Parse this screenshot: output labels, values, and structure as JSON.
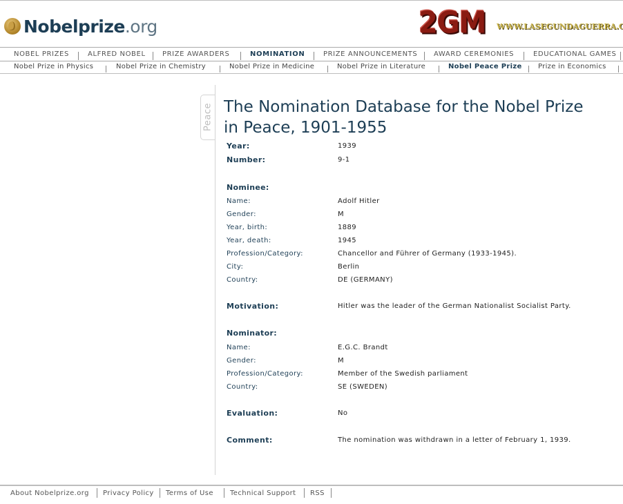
{
  "site": {
    "logo_text": "Nobelprize",
    "logo_suffix": ".org"
  },
  "brand": {
    "badge": "2GM",
    "url_text": "WWW.LASEGUNDAGUERRA.COM"
  },
  "nav_main": [
    {
      "label": "NOBEL PRIZES"
    },
    {
      "label": "ALFRED NOBEL"
    },
    {
      "label": "PRIZE AWARDERS"
    },
    {
      "label": "NOMINATION"
    },
    {
      "label": "PRIZE ANNOUNCEMENTS"
    },
    {
      "label": "AWARD CEREMONIES"
    },
    {
      "label": "EDUCATIONAL GAMES"
    }
  ],
  "nav_sub": [
    {
      "label": "Nobel Prize in Physics"
    },
    {
      "label": "Nobel Prize in Chemistry"
    },
    {
      "label": "Nobel Prize in Medicine"
    },
    {
      "label": "Nobel Prize in Literature"
    },
    {
      "label": "Nobel Peace Prize"
    },
    {
      "label": "Prize in Economics"
    }
  ],
  "side_tab": "Peace",
  "page": {
    "title_line1": "The Nomination Database for the Nobel Prize",
    "title_line2": "in Peace, 1901-1955"
  },
  "record": {
    "year_label": "Year:",
    "year": "1939",
    "number_label": "Number:",
    "number": "9-1",
    "nominee_heading": "Nominee:",
    "nominee": [
      {
        "label": "Name:",
        "value": "Adolf Hitler"
      },
      {
        "label": "Gender:",
        "value": "M"
      },
      {
        "label": "Year, birth:",
        "value": "1889"
      },
      {
        "label": "Year, death:",
        "value": "1945"
      },
      {
        "label": "Profession/Category:",
        "value": "Chancellor and Führer of Germany (1933-1945)."
      },
      {
        "label": "City:",
        "value": "Berlin"
      },
      {
        "label": "Country:",
        "value": "DE (GERMANY)"
      }
    ],
    "motivation_label": "Motivation:",
    "motivation": "Hitler was the leader of the German Nationalist Socialist Party.",
    "nominator_heading": "Nominator:",
    "nominator": [
      {
        "label": "Name:",
        "value": "E.G.C. Brandt"
      },
      {
        "label": "Gender:",
        "value": "M"
      },
      {
        "label": "Profession/Category:",
        "value": "Member of the Swedish parliament"
      },
      {
        "label": "Country:",
        "value": "SE (SWEDEN)"
      }
    ],
    "evaluation_label": "Evaluation:",
    "evaluation": "No",
    "comment_label": "Comment:",
    "comment": "The nomination was withdrawn in a letter of February 1, 1939."
  },
  "footer": [
    {
      "label": "About Nobelprize.org"
    },
    {
      "label": "Privacy Policy"
    },
    {
      "label": "Terms of Use"
    },
    {
      "label": "Technical Support"
    },
    {
      "label": "RSS"
    }
  ]
}
